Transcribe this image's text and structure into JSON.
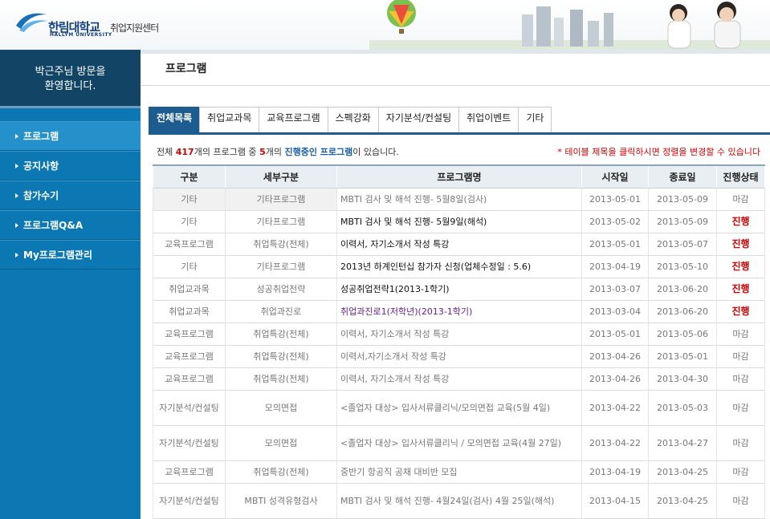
{
  "header": {
    "logo_name": "한림대학교",
    "logo_center": "취업지원센터",
    "logo_eng": "HALLYM UNIVERSITY"
  },
  "sidebar": {
    "welcome_line1": "박근주님 방문을",
    "welcome_line2": "환영합니다.",
    "items": [
      {
        "label": "프로그램",
        "active": true
      },
      {
        "label": "공지사항",
        "active": false
      },
      {
        "label": "참가수기",
        "active": false
      },
      {
        "label": "프로그램Q&A",
        "active": false
      },
      {
        "label": "My프로그램관리",
        "active": false
      }
    ]
  },
  "main": {
    "title": "프로그램",
    "tabs": [
      "전체목록",
      "취업교과목",
      "교육프로그램",
      "스펙강화",
      "자기분석/컨설팅",
      "취업이벤트",
      "기타"
    ],
    "info": {
      "prefix": "전체 ",
      "total": "417",
      "mid1": "개의 프로그램 중 ",
      "ongoing": "5",
      "mid2": "개의 ",
      "ongoing_label": "진행중인 프로그램",
      "suffix": "이 있습니다.",
      "notice": "* 테이블 제목을 클릭하시면 정렬을 변경할 수 있습니다"
    },
    "table": {
      "headers": [
        "구분",
        "세부구분",
        "프로그램명",
        "시작일",
        "종료일",
        "진행상태"
      ],
      "rows": [
        {
          "cat": "기타",
          "sub": "기타프로그램",
          "name": "MBTI 검사 및 해석 진행- 5월8일(검사)",
          "start": "2013-05-01",
          "end": "2013-05-09",
          "status": "마감"
        },
        {
          "cat": "기타",
          "sub": "기타프로그램",
          "name": "MBTI 검사 및 해석 진행- 5월9일(해석)",
          "start": "2013-05-02",
          "end": "2013-05-09",
          "status": "진행"
        },
        {
          "cat": "교육프로그램",
          "sub": "취업특강(전체)",
          "name": "이력서, 자기소개서 작성 특강",
          "start": "2013-05-01",
          "end": "2013-05-07",
          "status": "진행"
        },
        {
          "cat": "기타",
          "sub": "기타프로그램",
          "name": "2013년 하계인턴십 참가자 신청(업체수정일 : 5.6)",
          "start": "2013-04-19",
          "end": "2013-05-10",
          "status": "진행"
        },
        {
          "cat": "취업교과목",
          "sub": "성공취업전략",
          "name": "성공취업전략1(2013-1학기)",
          "start": "2013-03-07",
          "end": "2013-06-20",
          "status": "진행"
        },
        {
          "cat": "취업교과목",
          "sub": "취업과진로",
          "name": "취업과진로1(저학년)(2013-1학기)",
          "start": "2013-03-04",
          "end": "2013-06-20",
          "status": "진행"
        },
        {
          "cat": "교육프로그램",
          "sub": "취업특강(전체)",
          "name": "이력서, 자기소개서 작성 특강",
          "start": "2013-05-01",
          "end": "2013-05-06",
          "status": "마감"
        },
        {
          "cat": "교육프로그램",
          "sub": "취업특강(전체)",
          "name": "이력서,자기소개서 작성 특강",
          "start": "2013-04-26",
          "end": "2013-05-01",
          "status": "마감"
        },
        {
          "cat": "교육프로그램",
          "sub": "취업특강(전체)",
          "name": "이력서, 자기소개서 작성 특강",
          "start": "2013-04-26",
          "end": "2013-04-30",
          "status": "마감"
        },
        {
          "cat": "자기분석/컨설팅",
          "sub": "모의면접",
          "name": "<졸업자 대상> 입사서류클리닉/모의면접 교육(5월 4일)",
          "start": "2013-04-22",
          "end": "2013-05-03",
          "status": "마감"
        },
        {
          "cat": "자기분석/컨설팅",
          "sub": "모의면접",
          "name": "<졸업자 대상> 입사서류클리닉 / 모의면접 교육(4월 27일)",
          "start": "2013-04-22",
          "end": "2013-04-27",
          "status": "마감"
        },
        {
          "cat": "교육프로그램",
          "sub": "취업특강(전체)",
          "name": "중반기 항공직 공채 대비반 모집",
          "start": "2013-04-19",
          "end": "2013-04-25",
          "status": "마감"
        },
        {
          "cat": "자기분석/컨설팅",
          "sub": "MBTI 성격유형검사",
          "name": "MBTI 검사 및 해석 진행- 4월24일(검사) 4월 25일(해석)",
          "start": "2013-04-15",
          "end": "2013-04-25",
          "status": "마감"
        }
      ]
    }
  },
  "colors": {
    "sidebar": "#0b78b4",
    "sidebar_welcome": "#124466",
    "tab_active": "#1c5c8e",
    "status_ongoing": "#d40000"
  }
}
